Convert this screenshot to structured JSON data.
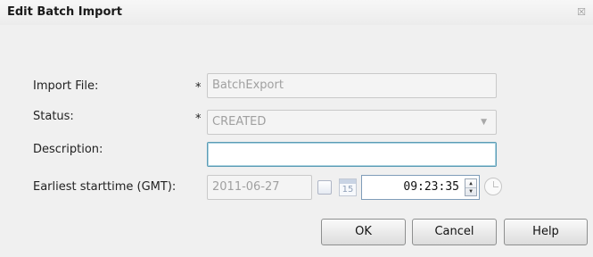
{
  "dialog": {
    "title": "Edit Batch Import",
    "close_glyph": "☒"
  },
  "form": {
    "import_file": {
      "label": "Import File:",
      "required_mark": "*",
      "value": "BatchExport"
    },
    "status": {
      "label": "Status:",
      "required_mark": "*",
      "selected": "CREATED"
    },
    "description": {
      "label": "Description:",
      "value": ""
    },
    "earliest_starttime": {
      "label": "Earliest starttime (GMT):",
      "date": "2011-06-27",
      "calendar_day": "15",
      "time": "09:23:35"
    }
  },
  "buttons": {
    "ok": "OK",
    "cancel": "Cancel",
    "help": "Help"
  },
  "icons": {
    "close": "close-icon",
    "dropdown": "chevron-down-icon",
    "calendar": "calendar-icon",
    "clock": "clock-icon",
    "spin_up": "spinner-up-icon",
    "spin_down": "spinner-down-icon"
  }
}
